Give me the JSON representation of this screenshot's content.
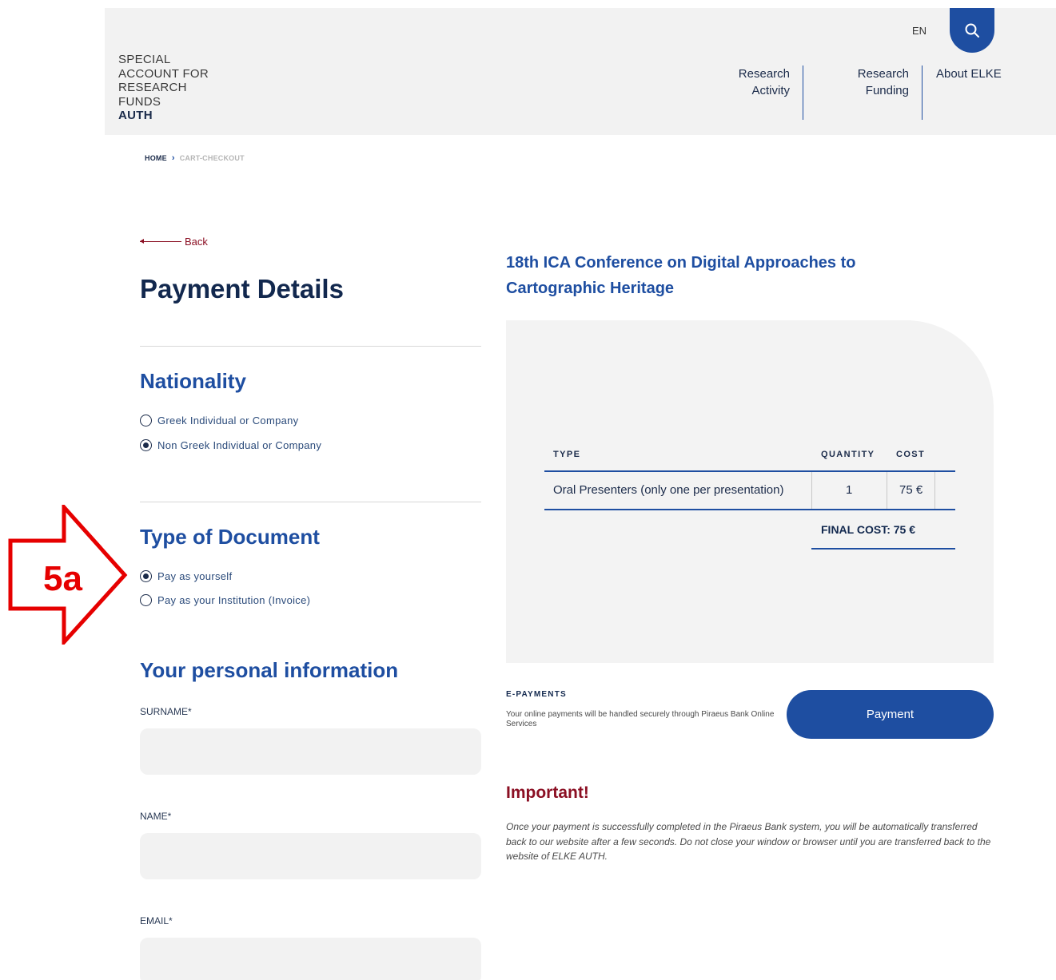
{
  "header": {
    "logo_lines": [
      "SPECIAL",
      "ACCOUNT FOR",
      "RESEARCH",
      "FUNDS"
    ],
    "logo_bold": "AUTH",
    "lang": "EN",
    "search_icon": "search-icon",
    "nav": [
      {
        "line1": "Research",
        "line2": "Activity"
      },
      {
        "line1": "Research",
        "line2": "Funding"
      },
      {
        "line1": "About ELKE",
        "line2": ""
      }
    ]
  },
  "breadcrumb": {
    "home": "HOME",
    "current": "CART-CHECKOUT"
  },
  "back_label": "Back",
  "page_title": "Payment Details",
  "nationality": {
    "title": "Nationality",
    "options": [
      {
        "label": "Greek Individual or Company",
        "selected": false
      },
      {
        "label": "Non Greek Individual or Company",
        "selected": true
      }
    ]
  },
  "document": {
    "title": "Type of Document",
    "options": [
      {
        "label": "Pay as yourself",
        "selected": true
      },
      {
        "label": "Pay as your Institution (Invoice)",
        "selected": false
      }
    ]
  },
  "personal": {
    "title": "Your personal information",
    "fields": [
      {
        "label": "SURNAME*",
        "value": ""
      },
      {
        "label": "NAME*",
        "value": ""
      },
      {
        "label": "EMAIL*",
        "value": ""
      }
    ]
  },
  "conference_title": "18th ICA Conference on Digital Approaches to Cartographic Heritage",
  "table": {
    "headers": {
      "type": "TYPE",
      "quantity": "QUANTITY",
      "cost": "COST"
    },
    "row": {
      "type": "Oral Presenters (only one per presentation)",
      "quantity": "1",
      "cost": "75 €"
    },
    "final_cost": "FINAL COST: 75 €"
  },
  "epayments": {
    "label": "E-PAYMENTS",
    "text": "Your online payments will be handled securely through Piraeus Bank Online Services",
    "button": "Payment"
  },
  "important": {
    "title": "Important!",
    "text": "Once your payment is successfully completed in the Piraeus Bank system, you will be automatically transferred back to our website after a few seconds. Do not close your window or browser until you are transferred back to the website of ELKE AUTH."
  },
  "annotation": {
    "label": "5a",
    "color": "#e60000"
  },
  "colors": {
    "primary": "#1e4ea1",
    "dark": "#12284e",
    "accent": "#8b0f23",
    "panel": "#f3f3f3"
  }
}
